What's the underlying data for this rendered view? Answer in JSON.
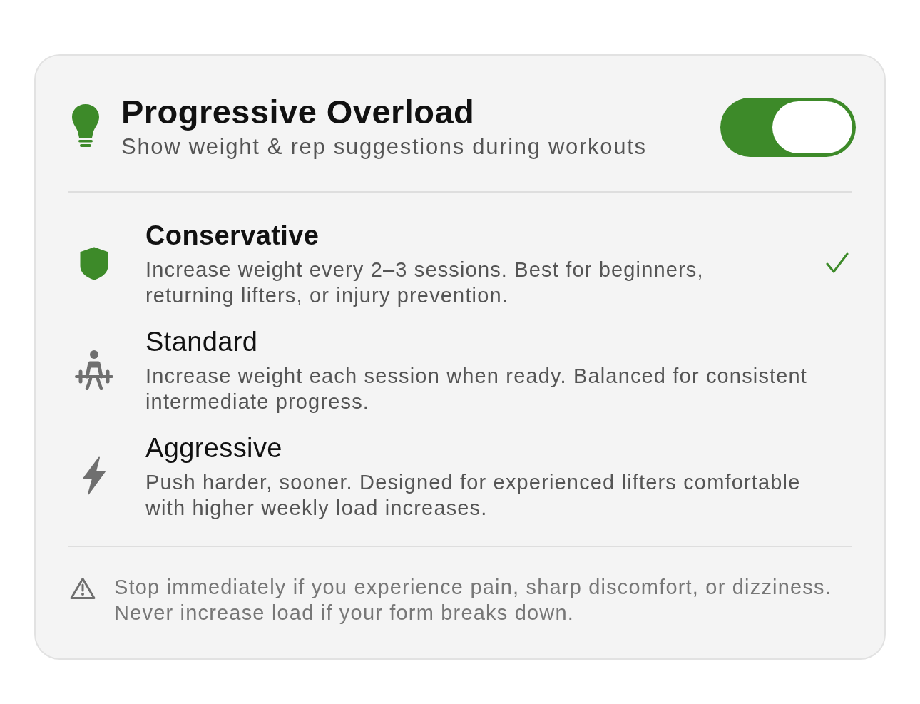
{
  "header": {
    "title": "Progressive Overload",
    "subtitle": "Show weight & rep suggestions during workouts",
    "toggle": {
      "on": true
    }
  },
  "options": [
    {
      "kind": "shield",
      "title": "Conservative",
      "description": "Increase weight every 2–3 sessions. Best for beginners, returning lifters, or injury prevention.",
      "selected": true
    },
    {
      "kind": "weightlifter",
      "title": "Standard",
      "description": "Increase weight each session when ready. Balanced for consistent intermediate progress.",
      "selected": false
    },
    {
      "kind": "bolt",
      "title": "Aggressive",
      "description": "Push harder, sooner. Designed for experienced lifters comfortable with higher weekly load increases.",
      "selected": false
    }
  ],
  "warning": {
    "text": "Stop immediately if you experience pain, sharp discomfort, or dizziness. Never increase load if your form breaks down."
  }
}
